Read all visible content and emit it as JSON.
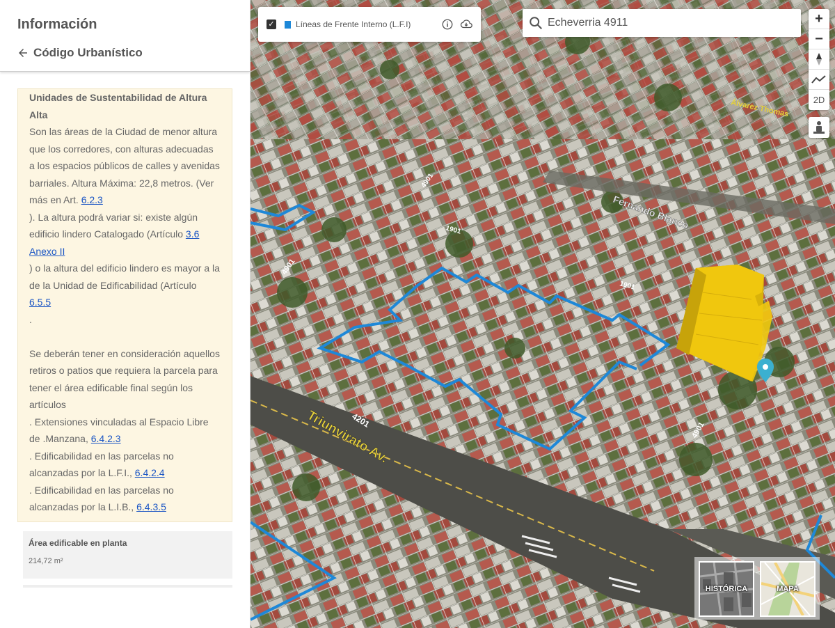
{
  "sidebar": {
    "title": "Información",
    "back_label": "Código Urbanístico",
    "section": {
      "heading": "Unidades de Sustentabilidad de Altura Alta",
      "t1": "Son las áreas de la Ciudad de menor altura que los corredores, con alturas adecuadas a los espacios públicos de calles y avenidas barriales. Altura Máxima: 22,8 metros. (Ver más en Art. ",
      "link1": "6.2.3",
      "t2": "). La altura podrá variar si: existe algún edificio lindero Catalogado (Artículo ",
      "link2": "3.6 Anexo II",
      "t3": ") o la altura del edificio lindero es mayor a la de la Unidad de Edificabilidad (Artículo ",
      "link3": "6.5.5",
      "t4": ".",
      "t5": "Se deberán tener en consideración aquellos retiros o patios que requiera la parcela para tener el área edificable final según los artículos",
      "t6": ". Extensiones vinculadas al Espacio Libre de .Manzana, ",
      "link4": "6.4.2.3",
      "t7": ". Edificabilidad en las parcelas no alcanzadas por la L.F.I., ",
      "link5": "6.4.2.4",
      "t8": ". Edificabilidad en las parcelas no alcanzadas por la L.I.B., ",
      "link6": "6.4.3.5"
    },
    "area": {
      "label": "Área edificable en planta",
      "value": "214,72 m²"
    }
  },
  "map": {
    "layer": {
      "label": "Líneas de Frente Interno (L.F.I)",
      "checked": true,
      "color": "#1e88d8",
      "info_icon": "info-icon",
      "download_icon": "cloud-download-icon"
    },
    "search": {
      "value": "Echeverria 4911",
      "icon": "search-icon"
    },
    "controls": {
      "zoom_in": "+",
      "zoom_out": "−",
      "mode_2d": "2D"
    },
    "street_labels": {
      "triunvirato": "Triunvirato Av.",
      "fernando": "Fernando Blanco",
      "alvarez": "Álvarez Thomas",
      "n4201": "4201",
      "n4901a": "4901",
      "n4901b": "4901",
      "n1901a": "1901",
      "n1901b": "1901",
      "n4901c": "4901"
    },
    "basemaps": [
      {
        "label": "HISTÓRICA"
      },
      {
        "label": "MAPA"
      }
    ],
    "colors": {
      "building": "#f2c90e",
      "lfi_line": "#1e88d8",
      "marker": "#3bb0d0"
    }
  }
}
